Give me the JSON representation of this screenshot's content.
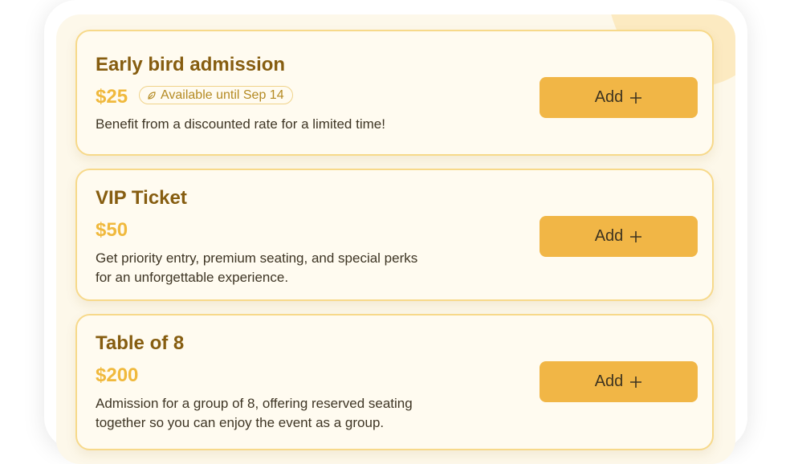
{
  "tickets": [
    {
      "name": "Early bird admission",
      "price": "$25",
      "badge": "Available until Sep 14",
      "description": "Benefit from a discounted rate for a limited time!",
      "button_label": "Add"
    },
    {
      "name": "VIP Ticket",
      "price": "$50",
      "description": "Get priority entry, premium seating, and special perks for an unforgettable experience.",
      "button_label": "Add"
    },
    {
      "name": "Table of 8",
      "price": "$200",
      "description": "Admission for a group of 8, offering reserved seating together so you can enjoy the event as a group.",
      "button_label": "Add"
    }
  ],
  "icons": {
    "badge_icon": "leaf-icon",
    "button_icon": "plus-icon"
  },
  "colors": {
    "accent": "#f1b646",
    "price": "#f0b93d",
    "title": "#865d10",
    "card_border": "#f7d98a",
    "panel_bg": "#fdf8ea"
  }
}
